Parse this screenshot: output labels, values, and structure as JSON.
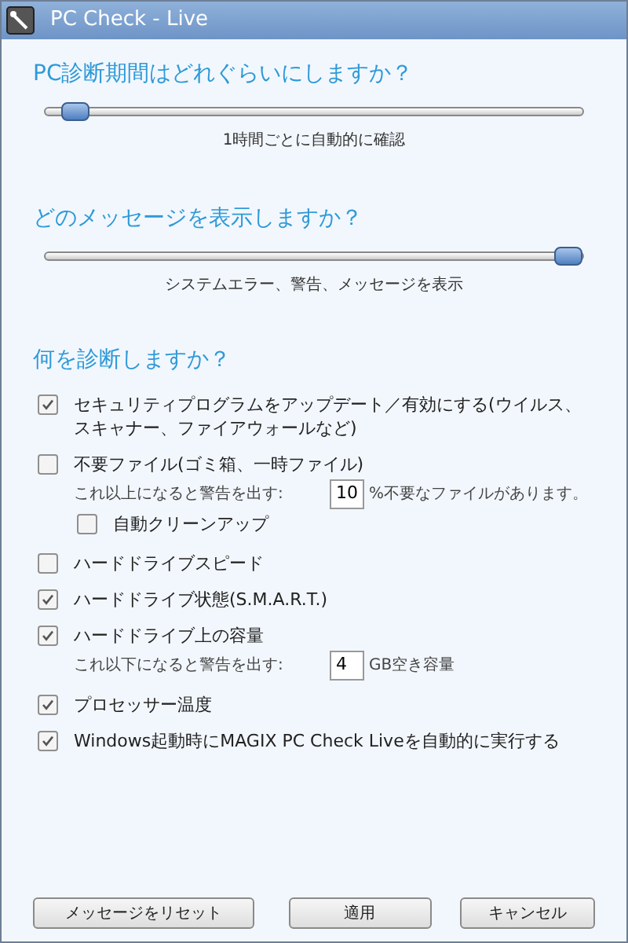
{
  "window": {
    "title": "PC Check - Live"
  },
  "frequency": {
    "heading": "PC診断期間はどれぐらいにしますか？",
    "level": 0.03,
    "caption": "1時間ごとに自動的に確認"
  },
  "messages": {
    "heading": "どのメッセージを表示しますか？",
    "level": 1,
    "caption": "システムエラー、警告、メッセージを表示"
  },
  "diagnose": {
    "heading": "何を診断しますか？",
    "items": [
      {
        "label": "セキュリティプログラムをアップデート／有効にする(ウイルス、スキャナー、ファイアウォールなど)",
        "checked": true
      },
      {
        "label": "不要ファイル(ゴミ箱、一時ファイル)",
        "checked": false,
        "threshold": {
          "label": "これ以上になると警告を出す:",
          "value": "10",
          "unit": "%不要なファイルがあります。"
        },
        "sub": {
          "label": "自動クリーンアップ",
          "checked": false
        }
      },
      {
        "label": "ハードドライブスピード",
        "checked": false
      },
      {
        "label": "ハードドライブ状態(S.M.A.R.T.)",
        "checked": true
      },
      {
        "label": "ハードドライブ上の容量",
        "checked": true,
        "threshold": {
          "label": "これ以下になると警告を出す:",
          "value": "4",
          "unit": "GB空き容量"
        }
      },
      {
        "label": "プロセッサー温度",
        "checked": true
      },
      {
        "label": "Windows起動時にMAGIX PC Check Liveを自動的に実行する",
        "checked": true
      }
    ]
  },
  "buttons": [
    "メッセージをリセット",
    "適用",
    "キャンセル"
  ]
}
